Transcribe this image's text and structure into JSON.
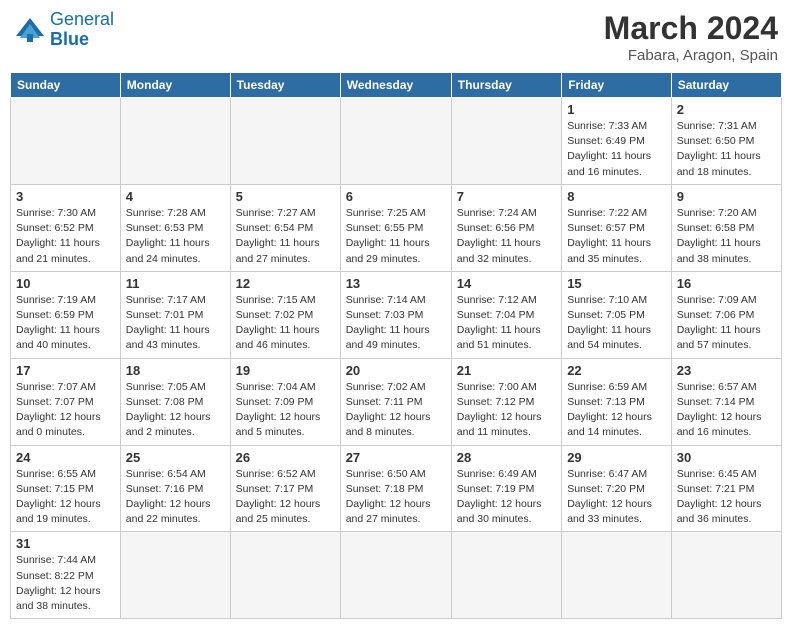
{
  "header": {
    "logo_general": "General",
    "logo_blue": "Blue",
    "month": "March 2024",
    "location": "Fabara, Aragon, Spain"
  },
  "weekdays": [
    "Sunday",
    "Monday",
    "Tuesday",
    "Wednesday",
    "Thursday",
    "Friday",
    "Saturday"
  ],
  "weeks": [
    [
      {
        "day": "",
        "info": ""
      },
      {
        "day": "",
        "info": ""
      },
      {
        "day": "",
        "info": ""
      },
      {
        "day": "",
        "info": ""
      },
      {
        "day": "",
        "info": ""
      },
      {
        "day": "1",
        "info": "Sunrise: 7:33 AM\nSunset: 6:49 PM\nDaylight: 11 hours and 16 minutes."
      },
      {
        "day": "2",
        "info": "Sunrise: 7:31 AM\nSunset: 6:50 PM\nDaylight: 11 hours and 18 minutes."
      }
    ],
    [
      {
        "day": "3",
        "info": "Sunrise: 7:30 AM\nSunset: 6:52 PM\nDaylight: 11 hours and 21 minutes."
      },
      {
        "day": "4",
        "info": "Sunrise: 7:28 AM\nSunset: 6:53 PM\nDaylight: 11 hours and 24 minutes."
      },
      {
        "day": "5",
        "info": "Sunrise: 7:27 AM\nSunset: 6:54 PM\nDaylight: 11 hours and 27 minutes."
      },
      {
        "day": "6",
        "info": "Sunrise: 7:25 AM\nSunset: 6:55 PM\nDaylight: 11 hours and 29 minutes."
      },
      {
        "day": "7",
        "info": "Sunrise: 7:24 AM\nSunset: 6:56 PM\nDaylight: 11 hours and 32 minutes."
      },
      {
        "day": "8",
        "info": "Sunrise: 7:22 AM\nSunset: 6:57 PM\nDaylight: 11 hours and 35 minutes."
      },
      {
        "day": "9",
        "info": "Sunrise: 7:20 AM\nSunset: 6:58 PM\nDaylight: 11 hours and 38 minutes."
      }
    ],
    [
      {
        "day": "10",
        "info": "Sunrise: 7:19 AM\nSunset: 6:59 PM\nDaylight: 11 hours and 40 minutes."
      },
      {
        "day": "11",
        "info": "Sunrise: 7:17 AM\nSunset: 7:01 PM\nDaylight: 11 hours and 43 minutes."
      },
      {
        "day": "12",
        "info": "Sunrise: 7:15 AM\nSunset: 7:02 PM\nDaylight: 11 hours and 46 minutes."
      },
      {
        "day": "13",
        "info": "Sunrise: 7:14 AM\nSunset: 7:03 PM\nDaylight: 11 hours and 49 minutes."
      },
      {
        "day": "14",
        "info": "Sunrise: 7:12 AM\nSunset: 7:04 PM\nDaylight: 11 hours and 51 minutes."
      },
      {
        "day": "15",
        "info": "Sunrise: 7:10 AM\nSunset: 7:05 PM\nDaylight: 11 hours and 54 minutes."
      },
      {
        "day": "16",
        "info": "Sunrise: 7:09 AM\nSunset: 7:06 PM\nDaylight: 11 hours and 57 minutes."
      }
    ],
    [
      {
        "day": "17",
        "info": "Sunrise: 7:07 AM\nSunset: 7:07 PM\nDaylight: 12 hours and 0 minutes."
      },
      {
        "day": "18",
        "info": "Sunrise: 7:05 AM\nSunset: 7:08 PM\nDaylight: 12 hours and 2 minutes."
      },
      {
        "day": "19",
        "info": "Sunrise: 7:04 AM\nSunset: 7:09 PM\nDaylight: 12 hours and 5 minutes."
      },
      {
        "day": "20",
        "info": "Sunrise: 7:02 AM\nSunset: 7:11 PM\nDaylight: 12 hours and 8 minutes."
      },
      {
        "day": "21",
        "info": "Sunrise: 7:00 AM\nSunset: 7:12 PM\nDaylight: 12 hours and 11 minutes."
      },
      {
        "day": "22",
        "info": "Sunrise: 6:59 AM\nSunset: 7:13 PM\nDaylight: 12 hours and 14 minutes."
      },
      {
        "day": "23",
        "info": "Sunrise: 6:57 AM\nSunset: 7:14 PM\nDaylight: 12 hours and 16 minutes."
      }
    ],
    [
      {
        "day": "24",
        "info": "Sunrise: 6:55 AM\nSunset: 7:15 PM\nDaylight: 12 hours and 19 minutes."
      },
      {
        "day": "25",
        "info": "Sunrise: 6:54 AM\nSunset: 7:16 PM\nDaylight: 12 hours and 22 minutes."
      },
      {
        "day": "26",
        "info": "Sunrise: 6:52 AM\nSunset: 7:17 PM\nDaylight: 12 hours and 25 minutes."
      },
      {
        "day": "27",
        "info": "Sunrise: 6:50 AM\nSunset: 7:18 PM\nDaylight: 12 hours and 27 minutes."
      },
      {
        "day": "28",
        "info": "Sunrise: 6:49 AM\nSunset: 7:19 PM\nDaylight: 12 hours and 30 minutes."
      },
      {
        "day": "29",
        "info": "Sunrise: 6:47 AM\nSunset: 7:20 PM\nDaylight: 12 hours and 33 minutes."
      },
      {
        "day": "30",
        "info": "Sunrise: 6:45 AM\nSunset: 7:21 PM\nDaylight: 12 hours and 36 minutes."
      }
    ],
    [
      {
        "day": "31",
        "info": "Sunrise: 7:44 AM\nSunset: 8:22 PM\nDaylight: 12 hours and 38 minutes."
      },
      {
        "day": "",
        "info": ""
      },
      {
        "day": "",
        "info": ""
      },
      {
        "day": "",
        "info": ""
      },
      {
        "day": "",
        "info": ""
      },
      {
        "day": "",
        "info": ""
      },
      {
        "day": "",
        "info": ""
      }
    ]
  ]
}
